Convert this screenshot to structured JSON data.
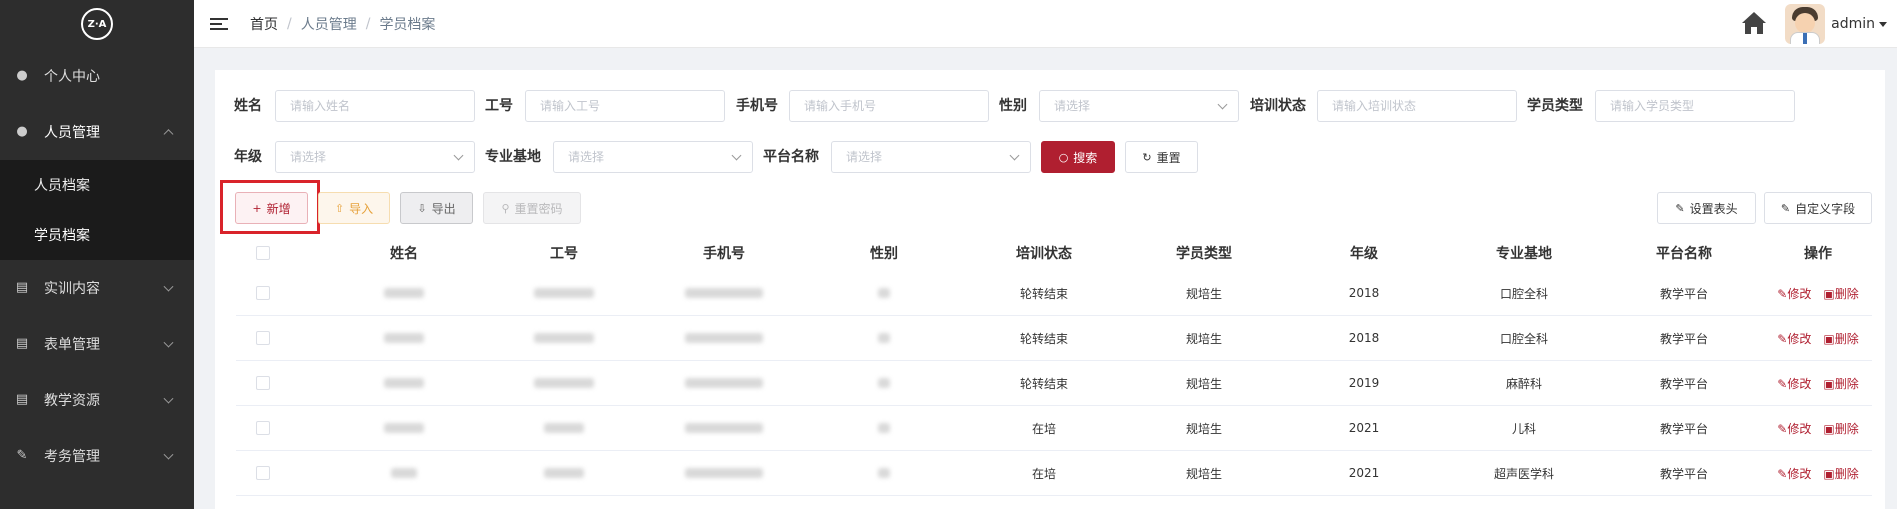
{
  "logo": {
    "text": "Z·A"
  },
  "sidebar": {
    "items": [
      {
        "label": "个人中心",
        "icon": "user-icon"
      },
      {
        "label": "人员管理",
        "icon": "users-icon",
        "open": true
      },
      {
        "label": "实训内容",
        "icon": "book-icon"
      },
      {
        "label": "表单管理",
        "icon": "form-icon"
      },
      {
        "label": "教学资源",
        "icon": "resource-icon"
      },
      {
        "label": "考务管理",
        "icon": "exam-icon"
      }
    ],
    "subitems": [
      {
        "label": "人员档案"
      },
      {
        "label": "学员档案",
        "active": true
      }
    ]
  },
  "header": {
    "breadcrumb": [
      "首页",
      "人员管理",
      "学员档案"
    ],
    "breadcrumb_sep": "/",
    "user": "admin"
  },
  "filters": {
    "name": {
      "label": "姓名",
      "placeholder": "请输入姓名"
    },
    "job_no": {
      "label": "工号",
      "placeholder": "请输入工号"
    },
    "phone": {
      "label": "手机号",
      "placeholder": "请输入手机号"
    },
    "gender": {
      "label": "性别",
      "placeholder": "请选择"
    },
    "train_status": {
      "label": "培训状态",
      "placeholder": "请输入培训状态"
    },
    "student_type": {
      "label": "学员类型",
      "placeholder": "请输入学员类型"
    },
    "grade": {
      "label": "年级",
      "placeholder": "请选择"
    },
    "base": {
      "label": "专业基地",
      "placeholder": "请选择"
    },
    "platform": {
      "label": "平台名称",
      "placeholder": "请选择"
    },
    "search_btn": "搜索",
    "reset_btn": "重置"
  },
  "toolbar": {
    "add": "新增",
    "import": "导入",
    "export": "导出",
    "reset_pw": "重置密码",
    "set_header": "设置表头",
    "custom_field": "自定义字段"
  },
  "table": {
    "columns": [
      "姓名",
      "工号",
      "手机号",
      "性别",
      "培训状态",
      "学员类型",
      "年级",
      "专业基地",
      "平台名称",
      "操作"
    ],
    "rows": [
      {
        "status": "轮转结束",
        "type": "规培生",
        "grade": "2018",
        "base": "口腔全科",
        "platform": "教学平台"
      },
      {
        "status": "轮转结束",
        "type": "规培生",
        "grade": "2018",
        "base": "口腔全科",
        "platform": "教学平台"
      },
      {
        "status": "轮转结束",
        "type": "规培生",
        "grade": "2019",
        "base": "麻醉科",
        "platform": "教学平台"
      },
      {
        "status": "在培",
        "type": "规培生",
        "grade": "2021",
        "base": "儿科",
        "platform": "教学平台"
      },
      {
        "status": "在培",
        "type": "规培生",
        "grade": "2021",
        "base": "超声医学科",
        "platform": "教学平台"
      }
    ],
    "edit_label": "修改",
    "delete_label": "删除"
  }
}
